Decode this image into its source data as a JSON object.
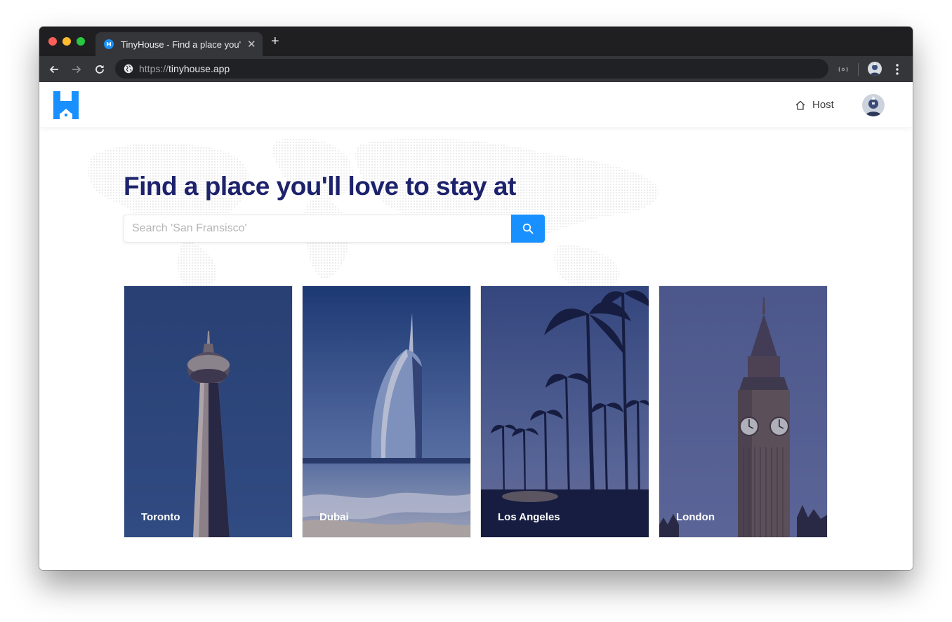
{
  "browser": {
    "tab_title": "TinyHouse - Find a place you'll love to stay at",
    "new_tab": "+",
    "close": "✕",
    "url_scheme": "https://",
    "url_host": "tinyhouse.app"
  },
  "header": {
    "host_label": "Host"
  },
  "hero": {
    "title": "Find a place you'll love to stay at",
    "search_placeholder": "Search 'San Fransisco'"
  },
  "listings": [
    {
      "label": "Toronto"
    },
    {
      "label": "Dubai"
    },
    {
      "label": "Los Angeles"
    },
    {
      "label": "London"
    }
  ],
  "colors": {
    "accent": "#1890ff",
    "title": "#1d226c"
  },
  "icons": {
    "search": "search-icon",
    "host": "home-icon"
  }
}
